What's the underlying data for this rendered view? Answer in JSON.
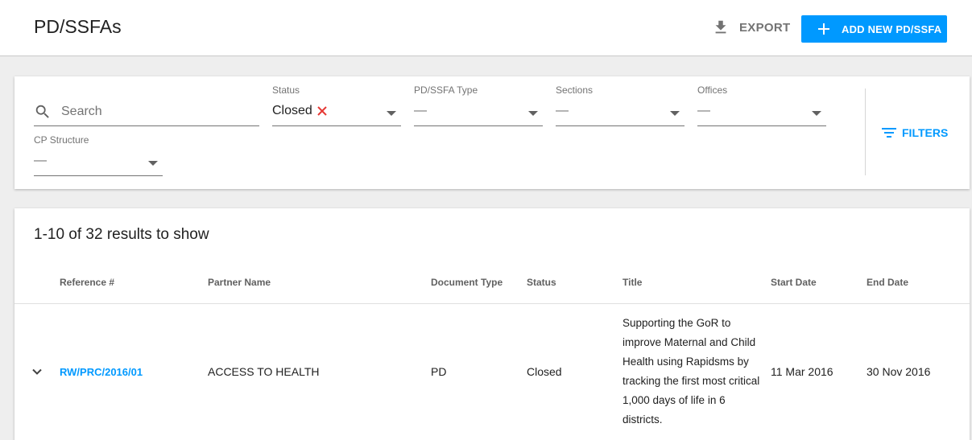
{
  "header": {
    "title": "PD/SSFAs",
    "export_label": "EXPORT",
    "add_label": "ADD NEW PD/SSFA",
    "accent_color": "#0099ff"
  },
  "filters": {
    "search_placeholder": "Search",
    "status": {
      "label": "Status",
      "value": "Closed"
    },
    "type": {
      "label": "PD/SSFA Type",
      "value": "—"
    },
    "sections": {
      "label": "Sections",
      "value": "—"
    },
    "offices": {
      "label": "Offices",
      "value": "—"
    },
    "cp_structure": {
      "label": "CP Structure",
      "value": "—"
    },
    "filters_label": "FILTERS"
  },
  "results": {
    "count_text": "1-10 of 32 results to show",
    "columns": [
      "Reference #",
      "Partner Name",
      "Document Type",
      "Status",
      "Title",
      "Start Date",
      "End Date"
    ],
    "rows": [
      {
        "reference": "RW/PRC/2016/01",
        "partner": "ACCESS TO HEALTH",
        "doc_type": "PD",
        "status": "Closed",
        "title": "Supporting the GoR to improve Maternal and Child Health using Rapidsms by tracking the first most critical 1,000 days of life in 6 districts.",
        "start": "11 Mar 2016",
        "end": "30 Nov 2016"
      }
    ]
  }
}
